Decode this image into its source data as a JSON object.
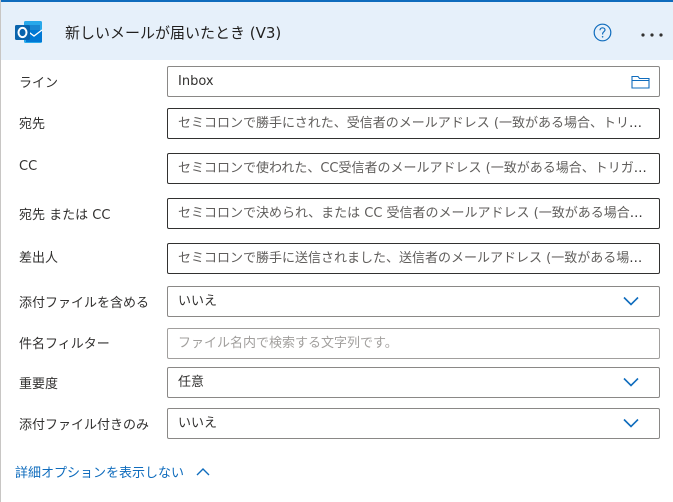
{
  "header": {
    "title": "新しいメールが届いたとき (V3)",
    "app_icon": "outlook-icon",
    "help_icon": "help-circle-icon",
    "more_icon": "more-ellipsis-icon"
  },
  "fields": [
    {
      "label": "ライン",
      "value": "Inbox",
      "placeholder": "",
      "kind": "folder",
      "icon": "folder-icon"
    },
    {
      "label": "宛先",
      "value": "",
      "placeholder": "セミコロンで勝手にされた、受信者のメールアドレス (一致がある場合、トリガ...",
      "kind": "text"
    },
    {
      "label": "CC",
      "value": "",
      "placeholder": "セミコロンで使われた、CC受信者のメールアドレス (一致がある場合、トリガー...",
      "kind": "text"
    },
    {
      "label": "宛先 または CC",
      "value": "",
      "placeholder": "セミコロンで決められ、または CC 受信者のメールアドレス (一致がある場合、...",
      "kind": "text"
    },
    {
      "label": "差出人",
      "value": "",
      "placeholder": "セミコロンで勝手に送信されました、送信者のメールアドレス (一致がある場合...",
      "kind": "text"
    },
    {
      "label": "添付ファイルを含める",
      "value": "いいえ",
      "placeholder": "",
      "kind": "dropdown"
    },
    {
      "label": "件名フィルター",
      "value": "",
      "placeholder": "ファイル名内で検索する文字列です。",
      "kind": "text-light"
    },
    {
      "label": "重要度",
      "value": "任意",
      "placeholder": "",
      "kind": "dropdown"
    },
    {
      "label": "添付ファイル付きのみ",
      "value": "いいえ",
      "placeholder": "",
      "kind": "dropdown"
    }
  ],
  "advanced_toggle": {
    "label": "詳細オプションを表示しない",
    "icon": "chevron-up-icon"
  },
  "colors": {
    "accent": "#0f6cbd",
    "header_bg": "#e6f0fa",
    "chevron": "#0f6cbd"
  }
}
